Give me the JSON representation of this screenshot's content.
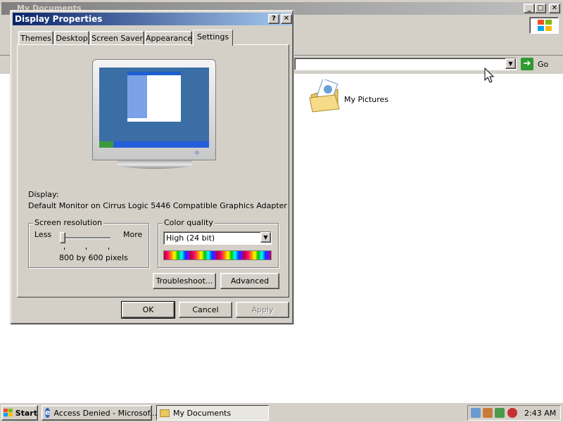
{
  "explorer": {
    "title": "My Documents",
    "go_label": "Go",
    "items": [
      {
        "label": "My Pictures"
      }
    ]
  },
  "dialog": {
    "title": "Display Properties",
    "help_btn": "?",
    "close_btn": "X",
    "tabs": [
      {
        "label": "Themes"
      },
      {
        "label": "Desktop"
      },
      {
        "label": "Screen Saver"
      },
      {
        "label": "Appearance"
      },
      {
        "label": "Settings"
      }
    ],
    "active_tab": "Settings",
    "display_label": "Display:",
    "display_value": "Default Monitor on Cirrus Logic 5446 Compatible Graphics Adapter",
    "resolution": {
      "group_title": "Screen resolution",
      "less": "Less",
      "more": "More",
      "value": "800 by 600 pixels",
      "slider_level": 0
    },
    "color": {
      "group_title": "Color quality",
      "selected": "High (24 bit)"
    },
    "troubleshoot": "Troubleshoot...",
    "advanced": "Advanced",
    "ok": "OK",
    "cancel": "Cancel",
    "apply": "Apply"
  },
  "taskbar": {
    "start": "Start",
    "tasks": [
      {
        "label": "Access Denied - Microsof..."
      },
      {
        "label": "My Documents"
      }
    ],
    "clock": "2:43 AM"
  },
  "colors": {
    "titlebar": "#0a246a",
    "titlebar_end": "#a6caf0",
    "face": "#d4d0c8",
    "desktop_preview": "#3a6ea5"
  }
}
